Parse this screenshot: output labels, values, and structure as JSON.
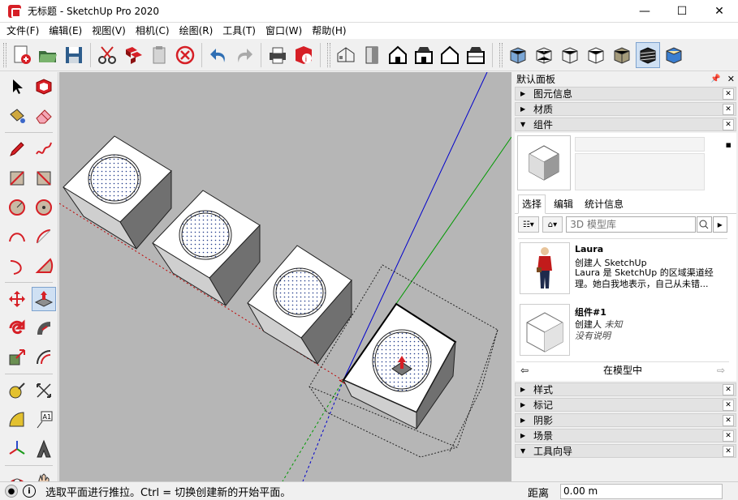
{
  "window": {
    "title": "无标题 - SketchUp Pro 2020",
    "minimize": "—",
    "maximize": "☐",
    "close": "✕"
  },
  "menu": [
    "文件(F)",
    "编辑(E)",
    "视图(V)",
    "相机(C)",
    "绘图(R)",
    "工具(T)",
    "窗口(W)",
    "帮助(H)"
  ],
  "tray": {
    "title": "默认面板",
    "panels_top": [
      {
        "label": "图元信息",
        "expanded": false
      },
      {
        "label": "材质",
        "expanded": false
      },
      {
        "label": "组件",
        "expanded": true
      }
    ],
    "panels_bottom": [
      {
        "label": "样式",
        "expanded": false
      },
      {
        "label": "标记",
        "expanded": false
      },
      {
        "label": "阴影",
        "expanded": false
      },
      {
        "label": "场景",
        "expanded": false
      },
      {
        "label": "工具向导",
        "expanded": true
      }
    ],
    "components": {
      "tabs": [
        "选择",
        "编辑",
        "统计信息"
      ],
      "active_tab": "选择",
      "search_placeholder": "3D 模型库",
      "results": [
        {
          "title": "Laura",
          "author_prefix": "创建人",
          "author": "SketchUp",
          "desc": "Laura 是 SketchUp 的区域渠道经理。她白我地表示，自己从未错..."
        },
        {
          "title": "组件#1",
          "author_prefix": "创建人",
          "author": "未知",
          "desc": "没有说明"
        }
      ],
      "location": "在模型中"
    }
  },
  "statusbar": {
    "hint": "选取平面进行推拉。Ctrl = 切换创建新的开始平面。",
    "measure_label": "距离",
    "measure_value": "0.00 m"
  },
  "colors": {
    "accent_red": "#d61f26",
    "viewport_bg": "#b6b6b6",
    "axis_red": "#c00000",
    "axis_green": "#009900",
    "axis_blue": "#0000cc"
  }
}
